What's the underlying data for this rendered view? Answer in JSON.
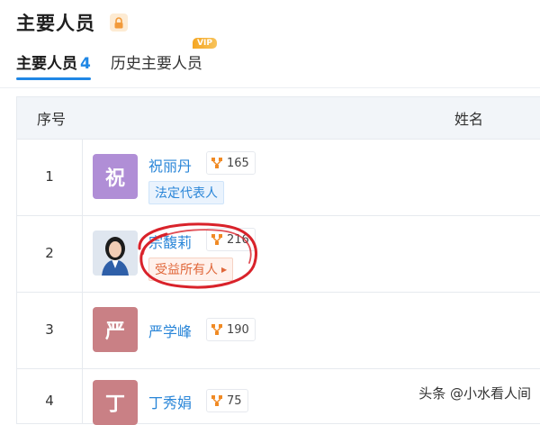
{
  "header": {
    "title": "主要人员",
    "lock_icon": "lock-icon"
  },
  "tabs": [
    {
      "label": "主要人员",
      "count": "4",
      "active": true
    },
    {
      "label": "历史主要人员",
      "badge": "VIP",
      "active": false
    }
  ],
  "table": {
    "headers": {
      "seq": "序号",
      "name": "姓名"
    },
    "rows": [
      {
        "seq": "1",
        "avatar_char": "祝",
        "avatar_color": "#b08ed6",
        "name": "祝丽丹",
        "relations": "165",
        "tag": "法定代表人",
        "tag_style": "blue"
      },
      {
        "seq": "2",
        "avatar_char": "",
        "avatar_color": "#3b5a86",
        "name": "宗馥莉",
        "relations": "216",
        "tag": "受益所有人",
        "tag_style": "orange"
      },
      {
        "seq": "3",
        "avatar_char": "严",
        "avatar_color": "#c98085",
        "name": "严学峰",
        "relations": "190",
        "tag": "",
        "tag_style": ""
      },
      {
        "seq": "4",
        "avatar_char": "丁",
        "avatar_color": "#c98085",
        "name": "丁秀娟",
        "relations": "75",
        "tag": "",
        "tag_style": ""
      }
    ]
  },
  "watermark": "头条 @小水看人间",
  "colors": {
    "accent": "#1f87e5",
    "link": "#2a86d8",
    "annotation_red": "#d9222a",
    "vip": "#f5a623"
  }
}
